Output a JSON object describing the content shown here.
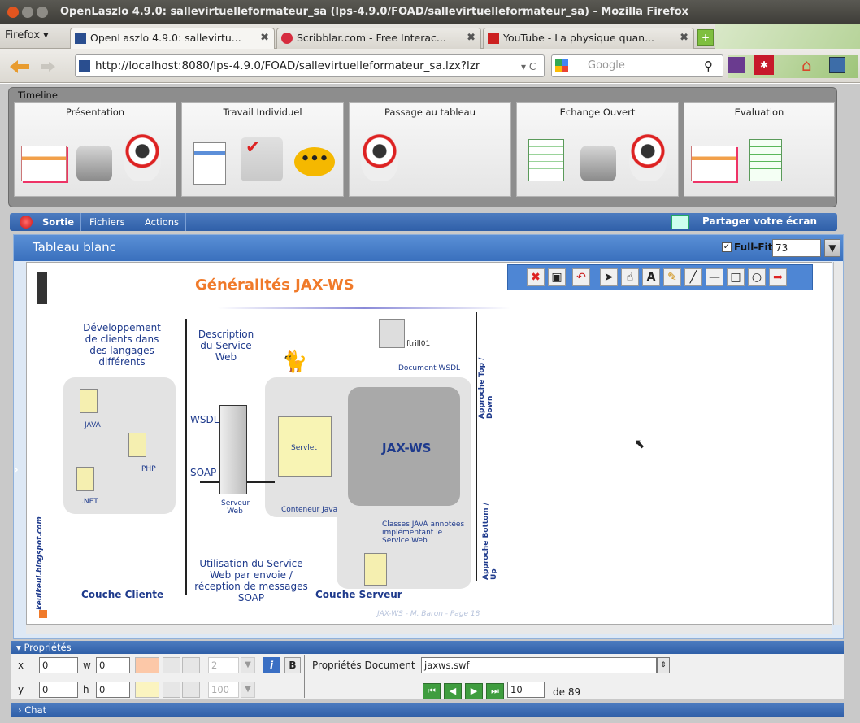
{
  "window": {
    "title": "OpenLaszlo 4.9.0: sallevirtuelleformateur_sa (lps-4.9.0/FOAD/sallevirtuelleformateur_sa) - Mozilla Firefox"
  },
  "browser": {
    "firefox_menu": "Firefox ▾",
    "tabs": [
      {
        "label": "OpenLaszlo 4.9.0: sallevirtu...",
        "close": "✖"
      },
      {
        "label": "Scribblar.com - Free Interac...",
        "close": "✖"
      },
      {
        "label": "YouTube - La physique quan...",
        "close": "✖"
      }
    ],
    "new_tab": "+",
    "url": "http://localhost:8080/lps-4.9.0/FOAD/sallevirtuelleformateur_sa.lzx?lzr",
    "search_placeholder": "Google"
  },
  "timeline": {
    "label": "Timeline",
    "phases": [
      "Présentation",
      "Travail Individuel",
      "Passage au tableau",
      "Echange Ouvert",
      "Evaluation"
    ]
  },
  "menubar": {
    "items": [
      "Sortie",
      "Fichiers",
      "Actions"
    ],
    "share": "Partager votre écran"
  },
  "whiteboard": {
    "title": "Tableau blanc",
    "fullfit": "Full-Fit",
    "zoom": "73",
    "zoom_arrow": "▼"
  },
  "slide": {
    "title": "Généralités JAX-WS",
    "dev_text": "Développement de clients dans des langages différents",
    "desc_text": "Description du Service Web",
    "wsdl": "WSDL",
    "soap": "SOAP",
    "java": "JAVA",
    "php": "PHP",
    "net": ".NET",
    "serveur": "Serveur Web",
    "servlet": "Servlet",
    "jaxws": "JAX-WS",
    "conteneur": "Conteneur Java",
    "docwsdl": "Document WSDL",
    "ftrill": "ftrill01",
    "classes": "Classes JAVA annotées implémentant le Service Web",
    "utilisation": "Utilisation du Service Web par envoie / réception de messages SOAP",
    "couche_cliente": "Couche Cliente",
    "couche_serveur": "Couche Serveur",
    "top_down": "Approche Top / Down",
    "bottom_up": "Approche Bottom / Up",
    "blog": "keulkeul.blogspot.com",
    "footer": "JAX-WS - M. Baron - Page 18"
  },
  "props": {
    "header": "Propriétés",
    "x_label": "x",
    "x_val": "0",
    "w_label": "w",
    "w_val": "0",
    "y_label": "y",
    "y_val": "0",
    "h_label": "h",
    "h_val": "0",
    "size_val": "2",
    "opacity_val": "100",
    "italic": "i",
    "bold": "B",
    "doc_label": "Propriétés Document",
    "doc_file": "jaxws.swf",
    "page": "10",
    "of_pages": "de 89"
  },
  "chat": {
    "label": "Chat"
  }
}
